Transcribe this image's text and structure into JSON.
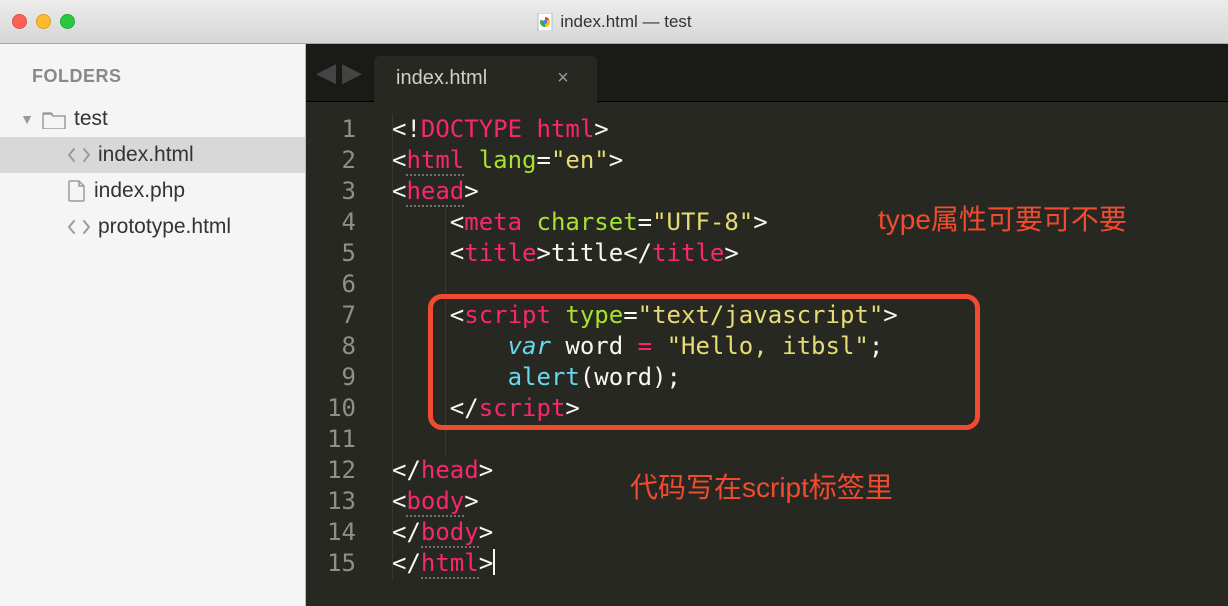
{
  "titlebar": {
    "title": "index.html — test"
  },
  "sidebar": {
    "heading": "FOLDERS",
    "root": {
      "name": "test"
    },
    "items": [
      {
        "icon": "code-icon",
        "name": "index.html",
        "selected": true
      },
      {
        "icon": "file-icon",
        "name": "index.php",
        "selected": false
      },
      {
        "icon": "code-icon",
        "name": "prototype.html",
        "selected": false
      }
    ]
  },
  "tabs": {
    "nav_prev": "◀",
    "nav_next": "▶",
    "active": {
      "label": "index.html",
      "close": "×"
    }
  },
  "gutter": {
    "max": 15
  },
  "code": {
    "l1": {
      "doctype": "DOCTYPE html"
    },
    "l2": {
      "tag": "html",
      "attr": "lang",
      "val": "\"en\""
    },
    "l3": {
      "tag": "head"
    },
    "l4": {
      "tag": "meta",
      "attr": "charset",
      "val": "\"UTF-8\""
    },
    "l5": {
      "tag": "title",
      "text": "title",
      "ctag": "title"
    },
    "l7": {
      "tag": "script",
      "attr": "type",
      "val": "\"text/javascript\""
    },
    "l8": {
      "kw": "var",
      "ident": "word",
      "op": " = ",
      "str": "\"Hello, itbsl\"",
      "semi": ";"
    },
    "l9": {
      "fn": "alert",
      "open": "(",
      "arg": "word",
      "close": ")",
      "semi": ";"
    },
    "l10": {
      "ctag": "script"
    },
    "l12": {
      "ctag": "head"
    },
    "l13": {
      "tag": "body"
    },
    "l14": {
      "ctag": "body"
    },
    "l15": {
      "ctag": "html"
    }
  },
  "annotations": {
    "a1": "type属性可要可不要",
    "a2": "代码写在script标签里"
  },
  "colors": {
    "accent_highlight": "#f14b2f",
    "editor_bg": "#272822",
    "tag": "#f92672",
    "string": "#e6db74",
    "attr": "#a6e22e",
    "storage": "#66d9ef"
  }
}
